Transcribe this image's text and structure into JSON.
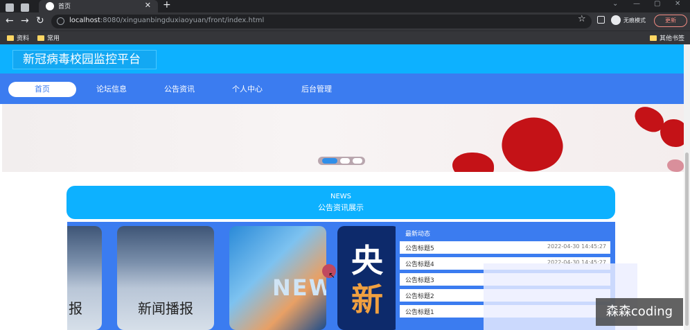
{
  "browser": {
    "tab_title": "首页",
    "url_host": "localhost",
    "url_path": ":8080/xinguanbingduxiaoyuan/front/index.html",
    "incognito_label": "无痕模式",
    "update_label": "更新",
    "bookmarks": [
      "资料",
      "常用"
    ],
    "other_bookmarks": "其他书签"
  },
  "site": {
    "title": "新冠病毒校园监控平台"
  },
  "nav": {
    "items": [
      "首页",
      "论坛信息",
      "公告资讯",
      "个人中心",
      "后台管理"
    ],
    "active_index": 0
  },
  "news": {
    "en": "NEWS",
    "zh": "公告资讯展示"
  },
  "cards": {
    "card1_label": "报",
    "card2_label": "新闻播报",
    "card3_text": "NEW",
    "card4_top": "央",
    "card4_bottom": "新"
  },
  "latest": {
    "title": "最新动态",
    "items": [
      {
        "title": "公告标题5",
        "date": "2022-04-30 14:45:27"
      },
      {
        "title": "公告标题4",
        "date": "2022-04-30 14:45:27"
      },
      {
        "title": "公告标题3",
        "date": ""
      },
      {
        "title": "公告标题2",
        "date": ""
      },
      {
        "title": "公告标题1",
        "date": ""
      }
    ]
  },
  "watermark": "森森coding",
  "colors": {
    "header": "#0db1ff",
    "nav": "#3b7cf0"
  }
}
